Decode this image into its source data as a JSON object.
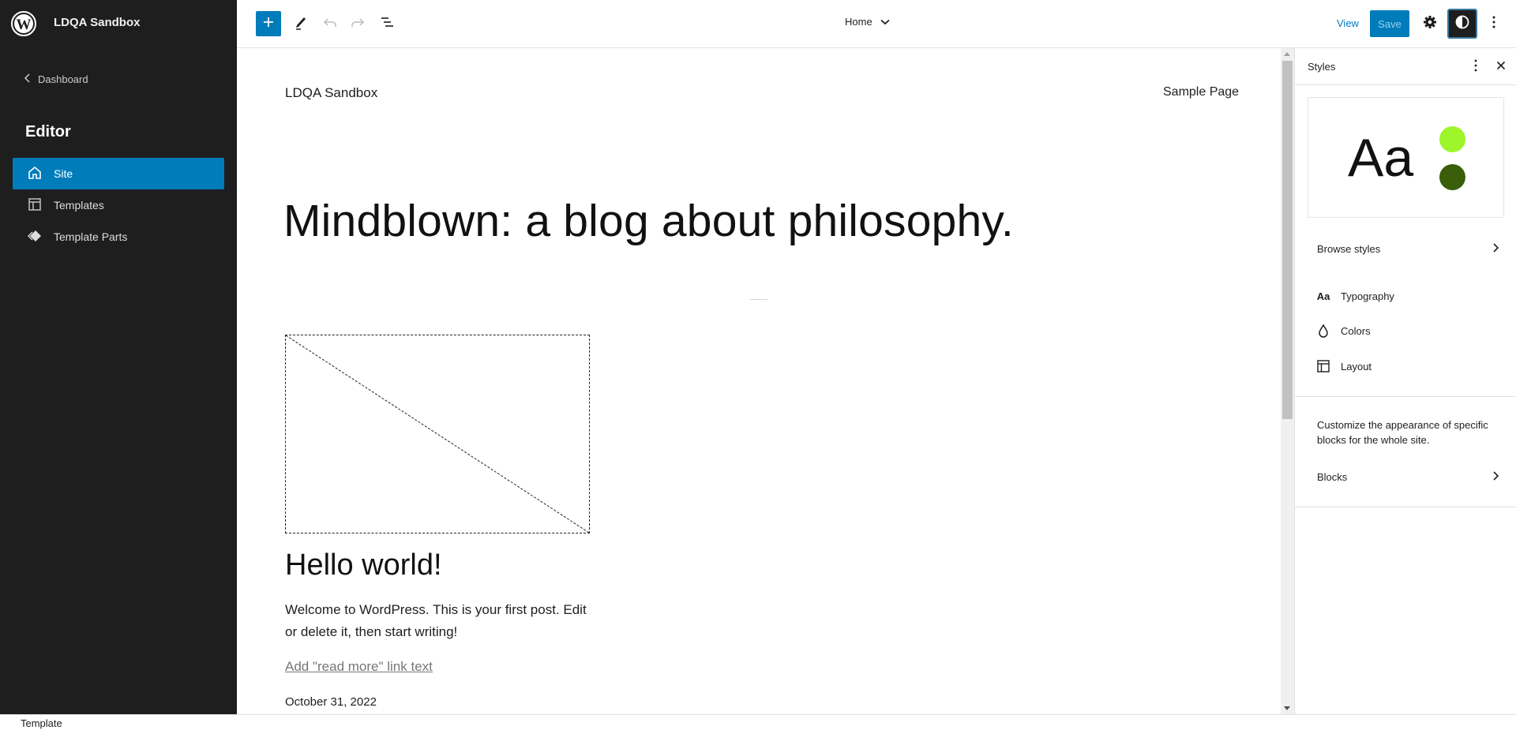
{
  "sidebar": {
    "site_name": "LDQA Sandbox",
    "back_label": "Dashboard",
    "section_title": "Editor",
    "items": [
      {
        "label": "Site",
        "icon": "home-icon",
        "active": true
      },
      {
        "label": "Templates",
        "icon": "layout-icon",
        "active": false
      },
      {
        "label": "Template Parts",
        "icon": "symbol-filled-icon",
        "active": false
      }
    ]
  },
  "toolbar": {
    "inserter_icon": "plus-icon",
    "tools_icon": "pencil-icon",
    "undo_icon": "undo-icon",
    "redo_icon": "redo-icon",
    "list_view_icon": "list-view-icon",
    "document_title": "Home",
    "view_label": "View",
    "save_label": "Save",
    "settings_icon": "gear-icon",
    "styles_icon": "contrast-icon",
    "more_icon": "kebab-icon"
  },
  "canvas": {
    "site_title": "LDQA Sandbox",
    "nav_link": "Sample Page",
    "heading": "Mindblown: a blog about philosophy.",
    "post": {
      "title": "Hello world!",
      "excerpt": "Welcome to WordPress. This is your first post. Edit or delete it, then start writing!",
      "read_more": "Add \"read more\" link text",
      "date": "October 31, 2022"
    }
  },
  "styles_panel": {
    "title": "Styles",
    "preview": {
      "sample_text": "Aa",
      "colors": [
        "#9ef52a",
        "#3a5e09"
      ]
    },
    "browse_label": "Browse styles",
    "items": [
      {
        "label": "Typography",
        "icon": "typography-icon"
      },
      {
        "label": "Colors",
        "icon": "droplet-icon"
      },
      {
        "label": "Layout",
        "icon": "layout-icon"
      }
    ],
    "blocks_description": "Customize the appearance of specific blocks for the whole site.",
    "blocks_label": "Blocks"
  },
  "footer": {
    "label": "Template"
  },
  "colors": {
    "accent": "#007cba",
    "sidebar_bg": "#1e1e1e"
  }
}
